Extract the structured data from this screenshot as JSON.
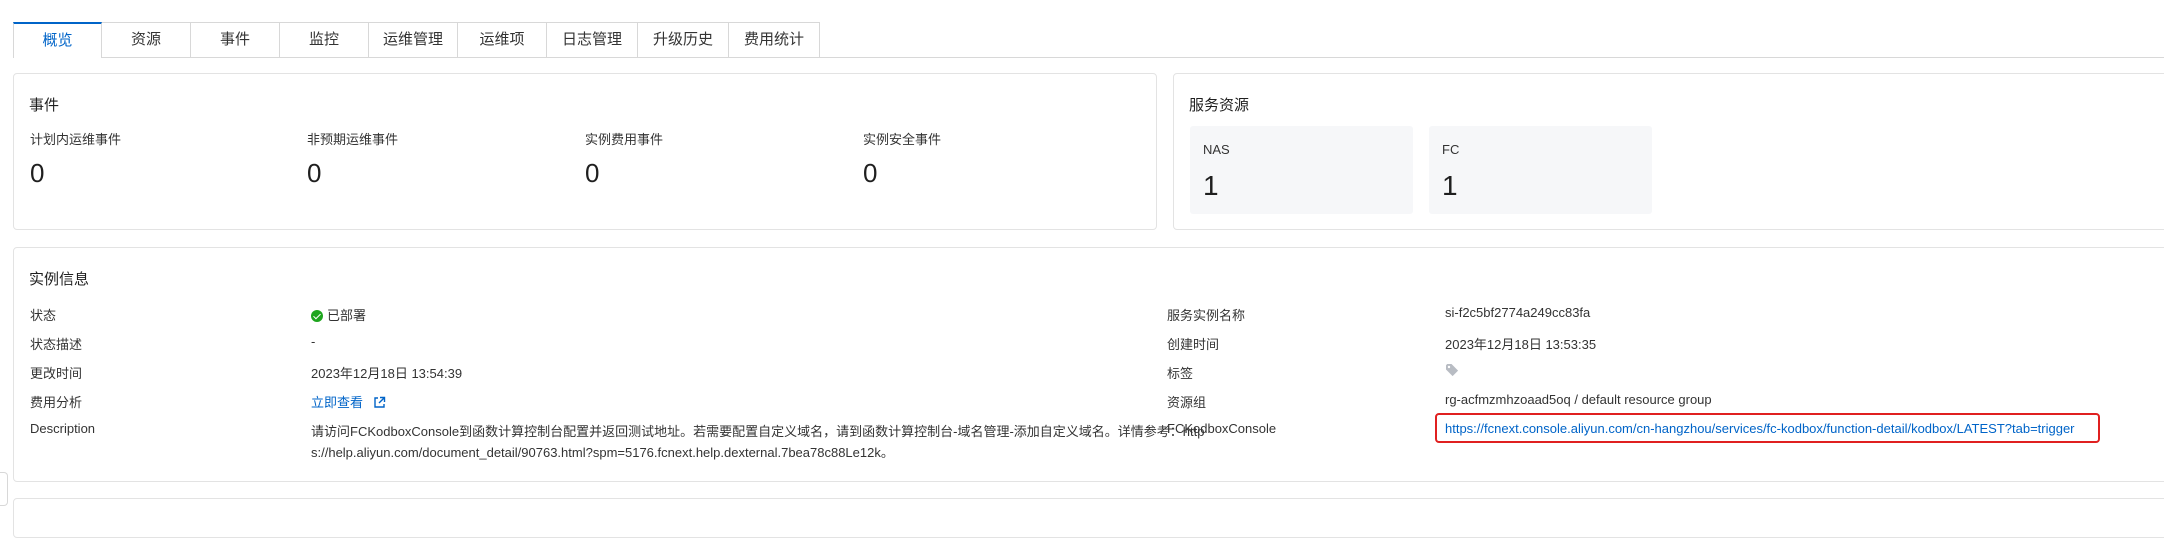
{
  "tabs": [
    {
      "label": "概览",
      "active": true
    },
    {
      "label": "资源"
    },
    {
      "label": "事件"
    },
    {
      "label": "监控"
    },
    {
      "label": "运维管理"
    },
    {
      "label": "运维项"
    },
    {
      "label": "日志管理"
    },
    {
      "label": "升级历史"
    },
    {
      "label": "费用统计"
    }
  ],
  "events": {
    "title": "事件",
    "items": [
      {
        "label": "计划内运维事件",
        "value": "0"
      },
      {
        "label": "非预期运维事件",
        "value": "0"
      },
      {
        "label": "实例费用事件",
        "value": "0"
      },
      {
        "label": "实例安全事件",
        "value": "0"
      }
    ]
  },
  "resources": {
    "title": "服务资源",
    "items": [
      {
        "label": "NAS",
        "value": "1"
      },
      {
        "label": "FC",
        "value": "1"
      }
    ]
  },
  "instance": {
    "title": "实例信息",
    "left": {
      "status_label": "状态",
      "status_value": "已部署",
      "status_desc_label": "状态描述",
      "status_desc_value": "-",
      "modified_label": "更改时间",
      "modified_value": "2023年12月18日 13:54:39",
      "cost_label": "费用分析",
      "cost_link": "立即查看",
      "desc_label": "Description",
      "desc_line1": "请访问FCKodboxConsole到函数计算控制台配置并返回测试地址。若需要配置自定义域名，请到函数计算控制台-域名管理-添加自定义域名。详情参考：http",
      "desc_line2": "s://help.aliyun.com/document_detail/90763.html?spm=5176.fcnext.help.dexternal.7bea78c88Le12k。"
    },
    "right": {
      "name_label": "服务实例名称",
      "name_value": "si-f2c5bf2774a249cc83fa",
      "created_label": "创建时间",
      "created_value": "2023年12月18日 13:53:35",
      "tags_label": "标签",
      "rg_label": "资源组",
      "rg_value": "rg-acfmzmhzoaad5oq / default resource group",
      "console_label": "FCKodboxConsole",
      "console_url": "https://fcnext.console.aliyun.com/cn-hangzhou/services/fc-kodbox/function-detail/kodbox/LATEST?tab=trigger"
    }
  },
  "colors": {
    "accent": "#0064c8",
    "success": "#1ea51e",
    "highlight": "#e02020"
  }
}
